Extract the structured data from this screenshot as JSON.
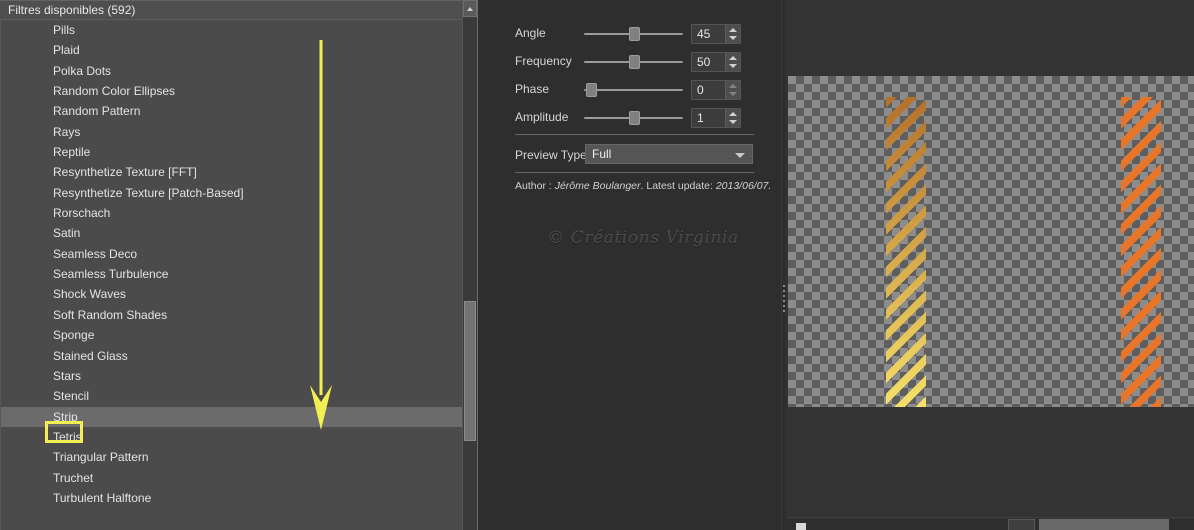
{
  "list_panel": {
    "header": "Filtres disponibles (592)",
    "selected": "Strip",
    "items": [
      "Pills",
      "Plaid",
      "Polka Dots",
      "Random Color Ellipses",
      "Random Pattern",
      "Rays",
      "Reptile",
      "Resynthetize Texture [FFT]",
      "Resynthetize Texture [Patch-Based]",
      "Rorschach",
      "Satin",
      "Seamless Deco",
      "Seamless Turbulence",
      "Shock Waves",
      "Soft Random Shades",
      "Sponge",
      "Stained Glass",
      "Stars",
      "Stencil",
      "Strip",
      "Tetris",
      "Triangular Pattern",
      "Truchet",
      "Turbulent Halftone"
    ],
    "scrollbar": {
      "up_arrow_icon": "triangle-up-icon"
    }
  },
  "annotation": {
    "arrow_color": "#f2ef52",
    "highlight_color": "#f2ef52",
    "highlight_target": "Strip"
  },
  "params_panel": {
    "rows": [
      {
        "label": "Angle",
        "value": "45",
        "slider_pct": 52,
        "dim": false
      },
      {
        "label": "Frequency",
        "value": "50",
        "slider_pct": 52,
        "dim": false
      },
      {
        "label": "Phase",
        "value": "0",
        "slider_pct": 2,
        "dim": true
      },
      {
        "label": "Amplitude",
        "value": "1",
        "slider_pct": 52,
        "dim": false
      }
    ],
    "preview_type": {
      "label": "Preview Type",
      "value": "Full",
      "arrow_icon": "chevron-down-icon"
    },
    "author": {
      "prefix": "Author : ",
      "name": "Jérôme Boulanger",
      "separator": ". Latest update: ",
      "date": "2013/06/07."
    },
    "watermark": "© Créations Virginia"
  },
  "preview_panel": {
    "strips": [
      {
        "name": "strip-left",
        "top_color": "#b5702a",
        "bottom_color": "#f5e06a"
      },
      {
        "name": "strip-right",
        "top_color": "#e8762a",
        "bottom_color": "#e8762a"
      }
    ],
    "footer": {
      "label": ""
    }
  },
  "colors": {
    "list_bg": "#4b4b4b",
    "panel_bg": "#2e2e2e",
    "selection": "#6b6b6b",
    "accent_yellow": "#f2ef52",
    "text": "#e3e3e3"
  }
}
